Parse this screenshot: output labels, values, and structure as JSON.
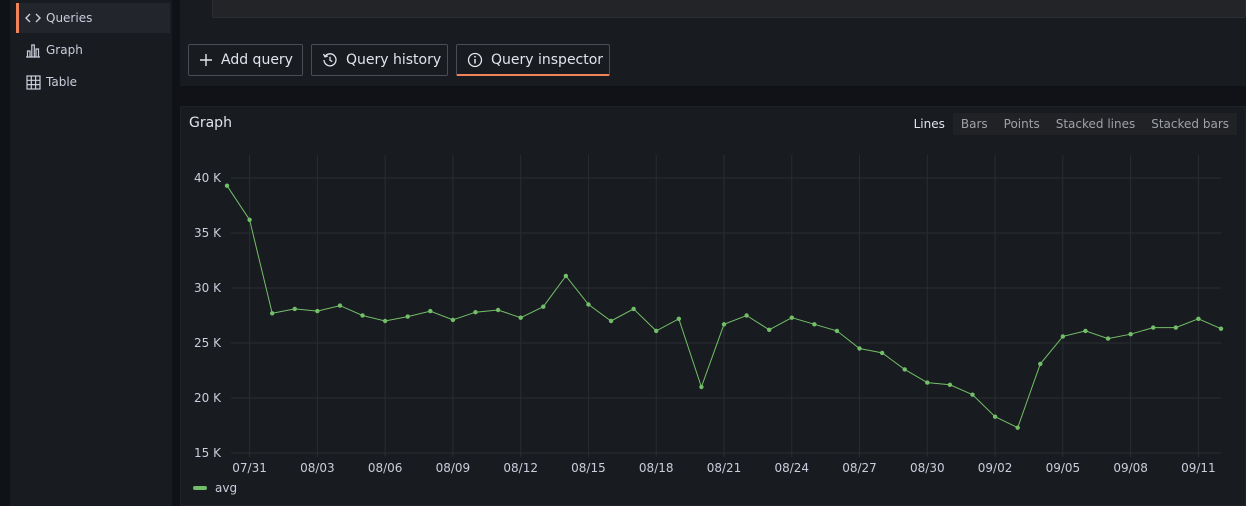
{
  "sidebar": {
    "items": [
      {
        "label": "Queries",
        "icon": "code-icon",
        "active": true
      },
      {
        "label": "Graph",
        "icon": "bar-chart-icon",
        "active": false
      },
      {
        "label": "Table",
        "icon": "table-icon",
        "active": false
      }
    ]
  },
  "toolbar": {
    "add_query": "Add query",
    "query_history": "Query history",
    "query_inspector": "Query inspector"
  },
  "graph": {
    "title": "Graph",
    "modes": [
      "Lines",
      "Bars",
      "Points",
      "Stacked lines",
      "Stacked bars"
    ],
    "selected_mode": "Lines"
  },
  "colors": {
    "accent": "#f0835a",
    "series": "#73bf69"
  },
  "chart_data": {
    "type": "line",
    "title": "Graph",
    "xlabel": "",
    "ylabel": "",
    "ylim": [
      15000,
      41000
    ],
    "yticks": [
      {
        "value": 15000,
        "label": "15 K"
      },
      {
        "value": 20000,
        "label": "20 K"
      },
      {
        "value": 25000,
        "label": "25 K"
      },
      {
        "value": 30000,
        "label": "30 K"
      },
      {
        "value": 35000,
        "label": "35 K"
      },
      {
        "value": 40000,
        "label": "40 K"
      }
    ],
    "xticks": [
      "07/31",
      "08/03",
      "08/06",
      "08/09",
      "08/12",
      "08/15",
      "08/18",
      "08/21",
      "08/24",
      "08/27",
      "08/30",
      "09/02",
      "09/05",
      "09/08",
      "09/11"
    ],
    "x": [
      "07/30",
      "07/31",
      "08/01",
      "08/02",
      "08/03",
      "08/04",
      "08/05",
      "08/06",
      "08/07",
      "08/08",
      "08/09",
      "08/10",
      "08/11",
      "08/12",
      "08/13",
      "08/14",
      "08/15",
      "08/16",
      "08/17",
      "08/18",
      "08/19",
      "08/20",
      "08/21",
      "08/22",
      "08/23",
      "08/24",
      "08/25",
      "08/26",
      "08/27",
      "08/28",
      "08/29",
      "08/30",
      "08/31",
      "09/01",
      "09/02",
      "09/03",
      "09/04",
      "09/05",
      "09/06",
      "09/07",
      "09/08",
      "09/09",
      "09/10",
      "09/11",
      "09/12"
    ],
    "series": [
      {
        "name": "avg",
        "values": [
          39300,
          36200,
          27700,
          28100,
          27900,
          28400,
          27500,
          27000,
          27400,
          27900,
          27100,
          27800,
          28000,
          27300,
          28300,
          31100,
          28500,
          27000,
          28100,
          26100,
          27200,
          21000,
          26700,
          27500,
          26200,
          27300,
          26700,
          26100,
          24500,
          24100,
          22600,
          21400,
          21200,
          20300,
          18300,
          17300,
          23100,
          25600,
          26100,
          25400,
          25800,
          26400,
          26400,
          27200,
          26300
        ]
      }
    ],
    "legend": "bottom-left",
    "grid": true
  }
}
